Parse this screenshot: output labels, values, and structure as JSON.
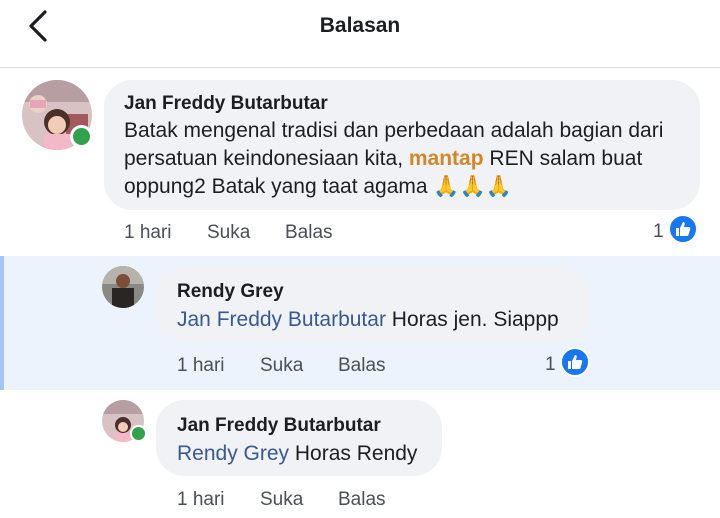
{
  "header": {
    "title": "Balasan"
  },
  "comments": [
    {
      "author": "Jan Freddy Butarbutar",
      "text_before": "Batak mengenal tradisi dan perbedaan adalah bagian dari persatuan keindonesiaan kita, ",
      "highlight": "mantap",
      "text_after": " REN salam buat oppung2 Batak yang taat agama 🙏🙏🙏",
      "time": "1 hari",
      "like_label": "Suka",
      "reply_label": "Balas",
      "reaction_count": "1"
    },
    {
      "author": "Rendy Grey",
      "mention": "Jan Freddy Butarbutar",
      "text": " Horas jen. Siappp",
      "time": "1 hari",
      "like_label": "Suka",
      "reply_label": "Balas",
      "reaction_count": "1"
    },
    {
      "author": "Jan Freddy Butarbutar",
      "mention": "Rendy Grey",
      "text": " Horas Rendy",
      "time": "1 hari",
      "like_label": "Suka",
      "reply_label": "Balas"
    }
  ],
  "colors": {
    "accent": "#1877f2",
    "online": "#31a24c",
    "bubble": "#f0f2f5",
    "highlight": "#d4862a",
    "mention": "#385898"
  }
}
